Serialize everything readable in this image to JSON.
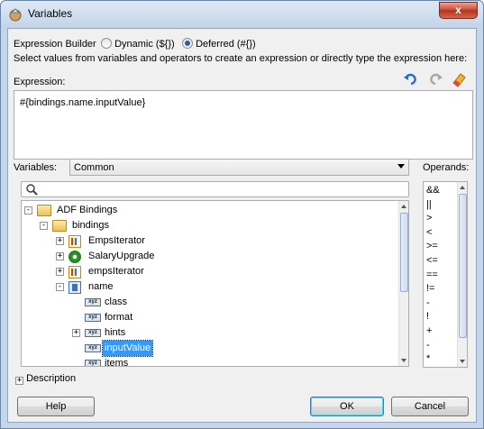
{
  "window": {
    "title": "Variables",
    "close_glyph": "x"
  },
  "expression_builder": {
    "label": "Expression Builder",
    "options": [
      {
        "label": "Dynamic (${})",
        "selected": false
      },
      {
        "label": "Deferred (#{})",
        "selected": true
      }
    ],
    "instructions": "Select values from variables and operators to create an expression or directly type the expression here:",
    "expression_label": "Expression:",
    "expression_value": "#{bindings.name.inputValue}",
    "toolbar_icons": [
      "undo-icon",
      "redo-icon",
      "clear-eraser-icon"
    ]
  },
  "variables": {
    "label": "Variables:",
    "selected_scope": "Common",
    "search_placeholder": "",
    "tree": [
      {
        "label": "ADF Bindings",
        "icon": "folder-icon",
        "expander": "-"
      },
      {
        "label": "bindings",
        "icon": "folder-icon",
        "expander": "-"
      },
      {
        "label": "EmpsIterator",
        "icon": "iterator-icon",
        "expander": "+"
      },
      {
        "label": "SalaryUpgrade",
        "icon": "gear-icon",
        "expander": "+"
      },
      {
        "label": "empsIterator",
        "icon": "iterator-icon",
        "expander": "+"
      },
      {
        "label": "name",
        "icon": "attribute-icon",
        "expander": "-"
      },
      {
        "label": "class",
        "icon": "xyz-icon",
        "expander": ""
      },
      {
        "label": "format",
        "icon": "xyz-icon",
        "expander": ""
      },
      {
        "label": "hints",
        "icon": "xyz-icon",
        "expander": "+"
      },
      {
        "label": "inputValue",
        "icon": "xyz-icon",
        "expander": "",
        "selected": true
      },
      {
        "label": "items",
        "icon": "xyz-icon",
        "expander": ""
      }
    ]
  },
  "operands": {
    "label": "Operands:",
    "items": [
      "&&",
      "||",
      ">",
      "<",
      ">=",
      "<=",
      "==",
      "!=",
      "-",
      "!",
      "+",
      "-",
      "*"
    ]
  },
  "description": {
    "label": "Description",
    "expander": "+"
  },
  "buttons": {
    "help": "Help",
    "ok": "OK",
    "cancel": "Cancel"
  }
}
